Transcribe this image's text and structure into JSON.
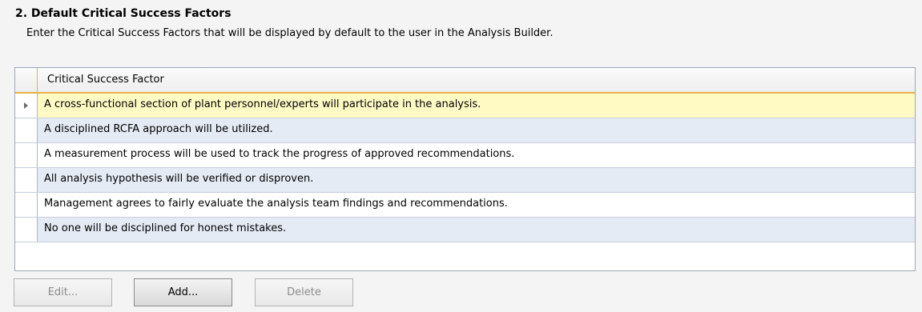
{
  "section": {
    "title": "2. Default Critical Success Factors",
    "description": "Enter the Critical Success Factors that will be displayed by default to the user in the Analysis Builder."
  },
  "grid": {
    "column_header": "Critical Success Factor",
    "rows": [
      {
        "text": "A cross-functional section of plant personnel/experts will participate in the analysis.",
        "selected": true
      },
      {
        "text": "A disciplined RCFA approach will be utilized.",
        "selected": false
      },
      {
        "text": "A measurement process will be used to track the progress of approved recommendations.",
        "selected": false
      },
      {
        "text": "All analysis hypothesis will be verified or disproven.",
        "selected": false
      },
      {
        "text": "Management agrees to fairly evaluate the analysis team findings and recommendations.",
        "selected": false
      },
      {
        "text": "No one will be disciplined for honest mistakes.",
        "selected": false
      }
    ]
  },
  "buttons": {
    "edit_label": "Edit...",
    "add_label": "Add...",
    "delete_label": "Delete",
    "edit_enabled": false,
    "add_enabled": true,
    "delete_enabled": false
  },
  "colors": {
    "selected_row": "#fff9c4",
    "alt_row": "#e4ebf4",
    "header_accent": "#e6b24a"
  }
}
